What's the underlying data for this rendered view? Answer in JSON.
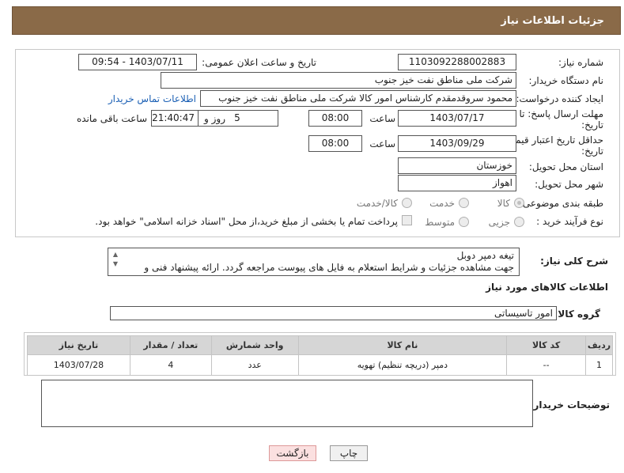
{
  "header": {
    "title": "جزئیات اطلاعات نیاز"
  },
  "form": {
    "need_number": {
      "label": "شماره نیاز:",
      "value": "1103092288002883"
    },
    "announce_datetime": {
      "label": "تاریخ و ساعت اعلان عمومی:",
      "value": "1403/07/11 - 09:54"
    },
    "buyer_org": {
      "label": "نام دستگاه خریدار:",
      "value": "شرکت ملی مناطق نفت خیز جنوب"
    },
    "requester": {
      "label": "ایجاد کننده درخواست:",
      "value": "محمود سروقدمقدم کارشناس امور کالا شرکت ملی مناطق نفت خیز جنوب",
      "contact_link": "اطلاعات تماس خریدار"
    },
    "reply_deadline": {
      "label_line1": "مهلت ارسال پاسخ: تا",
      "label_line2": "تاریخ:",
      "date": "1403/07/17",
      "time_label": "ساعت",
      "time": "08:00",
      "days": "5",
      "days_label": "روز و",
      "remaining": "21:40:47",
      "remaining_label": "ساعت باقی مانده"
    },
    "price_validity": {
      "label_line1": "حداقل تاریخ اعتبار قیمت: تا",
      "label_line2": "تاریخ:",
      "date": "1403/09/29",
      "time_label": "ساعت",
      "time": "08:00"
    },
    "delivery_province": {
      "label": "استان محل تحویل:",
      "value": "خوزستان"
    },
    "delivery_city": {
      "label": "شهر محل تحویل:",
      "value": "اهواز"
    },
    "category": {
      "label": "طبقه بندی موضوعی:",
      "options": [
        "کالا",
        "خدمت",
        "کالا/خدمت"
      ],
      "selected": "کالا"
    },
    "purchase_process": {
      "label": "نوع فرآیند خرید :",
      "options": [
        "جزیی",
        "متوسط"
      ],
      "payment_note": "پرداخت تمام یا بخشی از مبلغ خرید،از محل \"اسناد خزانه اسلامی\" خواهد بود."
    }
  },
  "description": {
    "label": "شرح کلی نیاز:",
    "line1": "تیغه دمپر دوبل",
    "line2": "جهت مشاهده جزئیات و شرایط استعلام به فایل های پیوست مراجعه گردد. ارائه پیشنهاد فنی و مالی به"
  },
  "goods_info": {
    "title": "اطلاعات کالاهای مورد نیاز",
    "group_label": "گروه کالا:",
    "group_value": "امور تاسیساتی"
  },
  "table": {
    "headers": [
      "ردیف",
      "کد کالا",
      "نام کالا",
      "واحد شمارش",
      "تعداد / مقدار",
      "تاریخ نیاز"
    ],
    "rows": [
      [
        "1",
        "--",
        "دمپر (دریچه تنظیم) تهویه",
        "عدد",
        "4",
        "1403/07/28"
      ]
    ]
  },
  "notes": {
    "label": "توضیحات خریدار:"
  },
  "buttons": {
    "print": "چاپ",
    "back": "بازگشت"
  }
}
